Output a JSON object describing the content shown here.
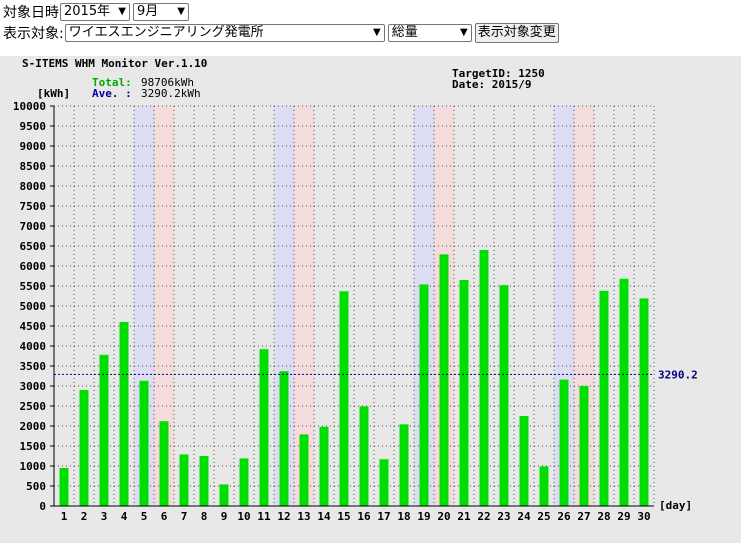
{
  "controls": {
    "date_label": "対象日時",
    "year_value": "2015年",
    "month_value": "9月",
    "target_label": "表示対象:",
    "target_value": "ワイエスエンジニアリング発電所",
    "type_value": "総量",
    "change_button": "表示対象変更"
  },
  "header": {
    "monitor_title": "S-ITEMS WHM Monitor Ver.1.10",
    "total_label": "Total:",
    "total_value": "98706kWh",
    "ave_label": "Ave. :",
    "ave_value": "3290.2kWh",
    "target_id": "TargetID: 1250",
    "date": "Date: 2015/9"
  },
  "colors": {
    "bar": "#00dd00",
    "weekend_sat": "#dcdcf2",
    "weekend_sun": "#f5dcdc",
    "average_line": "#000080",
    "total_label": "#00aa00",
    "ave_label": "#0000aa"
  },
  "chart_data": {
    "type": "bar",
    "ylabel": "[kWh]",
    "xlabel": "[day]",
    "ylim": [
      0,
      10000
    ],
    "ytick_step": 500,
    "grid": true,
    "categories": [
      "1",
      "2",
      "3",
      "4",
      "5",
      "6",
      "7",
      "8",
      "9",
      "10",
      "11",
      "12",
      "13",
      "14",
      "15",
      "16",
      "17",
      "18",
      "19",
      "20",
      "21",
      "22",
      "23",
      "24",
      "25",
      "26",
      "27",
      "28",
      "29",
      "30"
    ],
    "values": [
      950,
      2900,
      3780,
      4600,
      3130,
      2120,
      1290,
      1250,
      540,
      1190,
      3920,
      3370,
      1790,
      1980,
      5370,
      2490,
      1170,
      2040,
      5540,
      6290,
      5650,
      6400,
      5520,
      2250,
      990,
      3160,
      3000,
      5380,
      5680,
      5190
    ],
    "saturday_days": [
      5,
      12,
      19,
      26
    ],
    "sunday_days": [
      6,
      13,
      20,
      27
    ],
    "average": 3290.2,
    "average_label": "3290.2"
  }
}
